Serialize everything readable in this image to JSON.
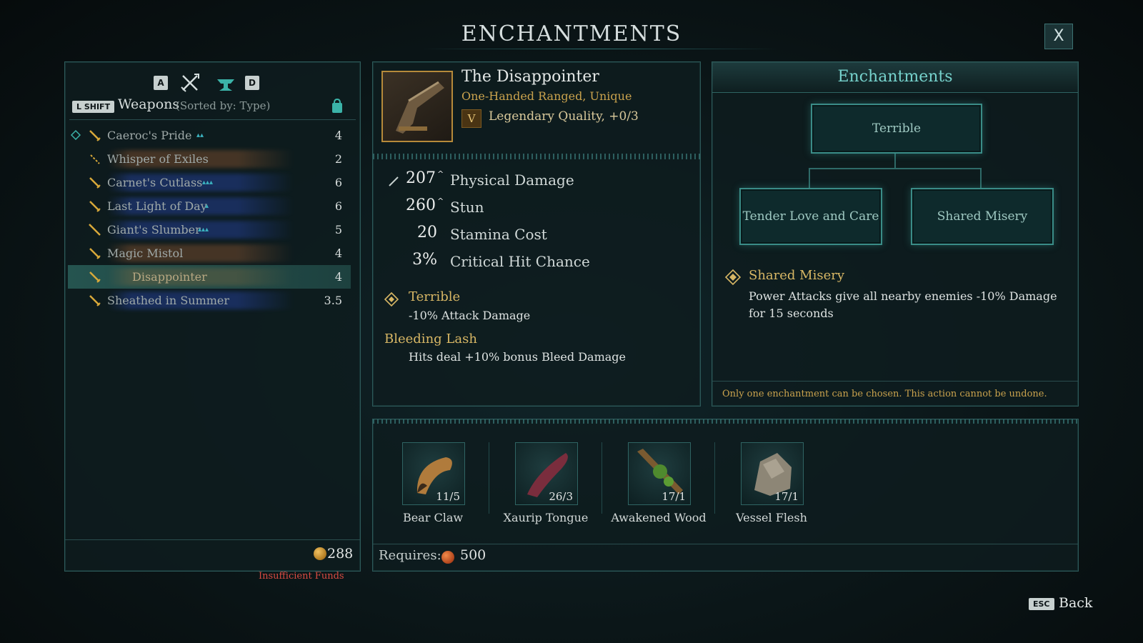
{
  "screen_title": "ENCHANTMENTS",
  "close_label": "X",
  "left": {
    "key_prev": "A",
    "key_next": "D",
    "shift_key": "L SHIFT",
    "category_label": "Weapons",
    "sort_label": "(Sorted by: Type)",
    "weapons": [
      {
        "name": "Caeroc's Pride",
        "level": "4",
        "traits": "▴▴",
        "glow": "rgba(0,0,0,0)",
        "equipped": true
      },
      {
        "name": "Whisper of Exiles",
        "level": "2",
        "traits": "",
        "glow": "rgba(150,90,50,0.55)",
        "equipped": false
      },
      {
        "name": "Carnet's Cutlass",
        "level": "6",
        "traits": "▴▴▴",
        "glow": "rgba(40,70,170,0.6)",
        "equipped": false
      },
      {
        "name": "Last Light of Day",
        "level": "6",
        "traits": "▴",
        "glow": "rgba(40,70,170,0.6)",
        "equipped": false
      },
      {
        "name": "Giant's Slumber",
        "level": "5",
        "traits": "▴▴▴",
        "glow": "rgba(40,70,170,0.6)",
        "equipped": false
      },
      {
        "name": "Magic Mistol",
        "level": "4",
        "traits": "",
        "glow": "rgba(150,90,50,0.55)",
        "equipped": false
      },
      {
        "name": "Disappointer",
        "level": "4",
        "traits": "",
        "glow": "rgba(150,110,60,0.4)",
        "equipped": false,
        "selected": true
      },
      {
        "name": "Sheathed in Summer",
        "level": "3.5",
        "traits": "",
        "glow": "rgba(40,70,170,0.6)",
        "equipped": false
      }
    ],
    "funds": "288",
    "insufficient_funds": "Insufficient Funds"
  },
  "item": {
    "name": "The Disappointer",
    "type": "One-Handed Ranged, Unique",
    "quality_badge": "V",
    "quality": "Legendary Quality, +0/3",
    "stats": [
      {
        "value": "207",
        "label": "Physical Damage",
        "up": true
      },
      {
        "value": "260",
        "label": "Stun",
        "up": true
      },
      {
        "value": "20",
        "label": "Stamina Cost",
        "up": false
      },
      {
        "value": "3%",
        "label": "Critical Hit Chance",
        "up": false
      }
    ],
    "enchant_1_name": "Terrible",
    "enchant_1_desc": "-10% Attack Damage",
    "enchant_2_name": "Bleeding Lash",
    "enchant_2_desc": "Hits deal +10% bonus Bleed Damage"
  },
  "enchant_panel": {
    "title": "Enchantments",
    "node_top": "Terrible",
    "node_left": "Tender Love and Care",
    "node_right": "Shared Misery",
    "selected_name": "Shared Misery",
    "selected_desc": "Power Attacks give all nearby enemies -10% Damage for 15 seconds",
    "footer_note": "Only one enchantment can be chosen. This action cannot be undone."
  },
  "materials": {
    "items": [
      {
        "name": "Bear Claw",
        "qty": "11/5",
        "icon": "claw-icon"
      },
      {
        "name": "Xaurip Tongue",
        "qty": "26/3",
        "icon": "tongue-icon"
      },
      {
        "name": "Awakened Wood",
        "qty": "17/1",
        "icon": "wood-icon"
      },
      {
        "name": "Vessel Flesh",
        "qty": "17/1",
        "icon": "rock-icon"
      }
    ],
    "requires_label": "Requires:",
    "requires_value": "500"
  },
  "back": {
    "key": "ESC",
    "label": "Back"
  },
  "colors": {
    "accent": "#3a8c87",
    "gold": "#d8b765",
    "warning": "#d94b42"
  }
}
